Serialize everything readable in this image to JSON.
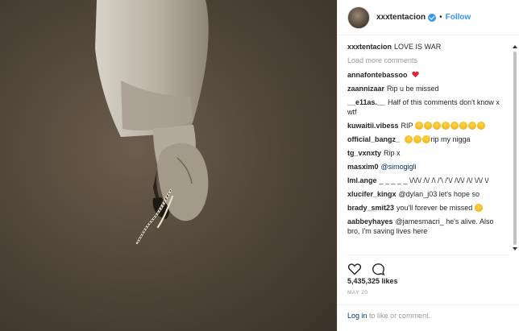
{
  "post": {
    "username": "xxxtentacion",
    "follow_label": "Follow",
    "separator": "•",
    "caption": {
      "user": "xxxtentacion",
      "text": "LOVE IS WAR"
    },
    "load_more": "Load more comments",
    "comments": [
      {
        "user": "annafontebassoo",
        "text": "",
        "emoji_heart": true
      },
      {
        "user": "zaannizaar",
        "text": "Rip u be missed"
      },
      {
        "user": "__e11as.__",
        "text": "Half of this comments don't know x wtf"
      },
      {
        "user": "kuwaitii.vibess",
        "text": "RIP",
        "emoji_count": 8
      },
      {
        "user": "official_bangz_",
        "text": "rip my nigga",
        "emoji_count": 3
      },
      {
        "user": "tg_vxnxty",
        "text": "Rip x"
      },
      {
        "user": "masxim0",
        "text": "@simogigli"
      },
      {
        "user": "lml.ange",
        "text": "_ _ _ _ _ \\/\\/\\/ /\\/ /\\ /'\\ /'\\/ /\\/\\/ /\\/ \\/\\/ \\/"
      },
      {
        "user": "xlucifer_kingx",
        "text": "@dylan_j03 let's hope so"
      },
      {
        "user": "brady_smit23",
        "text": "you'll forever be missed",
        "emoji_count": 1
      },
      {
        "user": "aabbeyhayes",
        "text": "@jamesmacri_ he's alive. Also bro, I'm saving lives here"
      }
    ],
    "likes": "5,435,325 likes",
    "date": "MAY 20",
    "login_link": "Log in",
    "login_text": "to like or comment."
  },
  "icons": {
    "like": "heart-outline-icon",
    "comment": "comment-bubble-icon"
  },
  "colors": {
    "link": "#3897f0",
    "verified": "#3897f0",
    "text": "#262626",
    "muted": "#999999"
  }
}
